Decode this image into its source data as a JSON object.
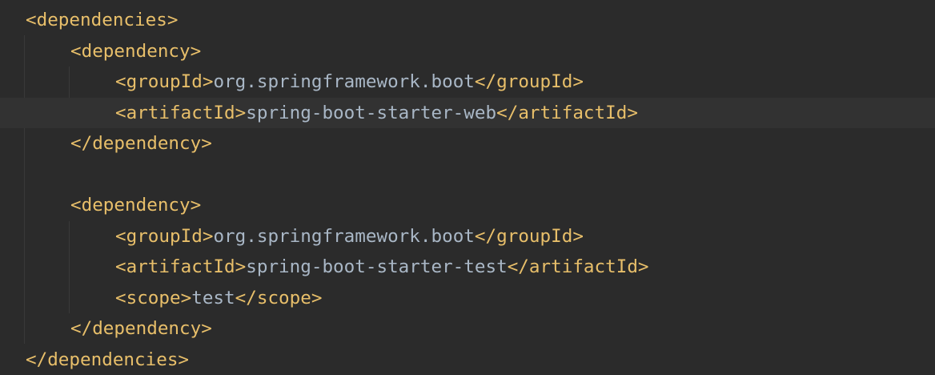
{
  "editor": {
    "language": "xml",
    "colors": {
      "background": "#2b2b2b",
      "current_line": "#323232",
      "tag": "#e8bf6a",
      "text": "#a9b7c6",
      "indent_guide": "#393939"
    },
    "lines": [
      {
        "indent": 0,
        "open": "<dependencies>",
        "text": "",
        "close": ""
      },
      {
        "indent": 1,
        "open": "<dependency>",
        "text": "",
        "close": ""
      },
      {
        "indent": 2,
        "open": "<groupId>",
        "text": "org.springframework.boot",
        "close": "</groupId>"
      },
      {
        "indent": 2,
        "open": "<artifactId>",
        "text": "spring-boot-starter-web",
        "close": "</artifactId>",
        "current": true
      },
      {
        "indent": 1,
        "open": "</dependency>",
        "text": "",
        "close": ""
      },
      {
        "indent": 0,
        "open": "",
        "text": "",
        "close": ""
      },
      {
        "indent": 1,
        "open": "<dependency>",
        "text": "",
        "close": ""
      },
      {
        "indent": 2,
        "open": "<groupId>",
        "text": "org.springframework.boot",
        "close": "</groupId>"
      },
      {
        "indent": 2,
        "open": "<artifactId>",
        "text": "spring-boot-starter-test",
        "close": "</artifactId>"
      },
      {
        "indent": 2,
        "open": "<scope>",
        "text": "test",
        "close": "</scope>"
      },
      {
        "indent": 1,
        "open": "</dependency>",
        "text": "",
        "close": ""
      },
      {
        "indent": 0,
        "open": "</dependencies>",
        "text": "",
        "close": ""
      }
    ]
  }
}
